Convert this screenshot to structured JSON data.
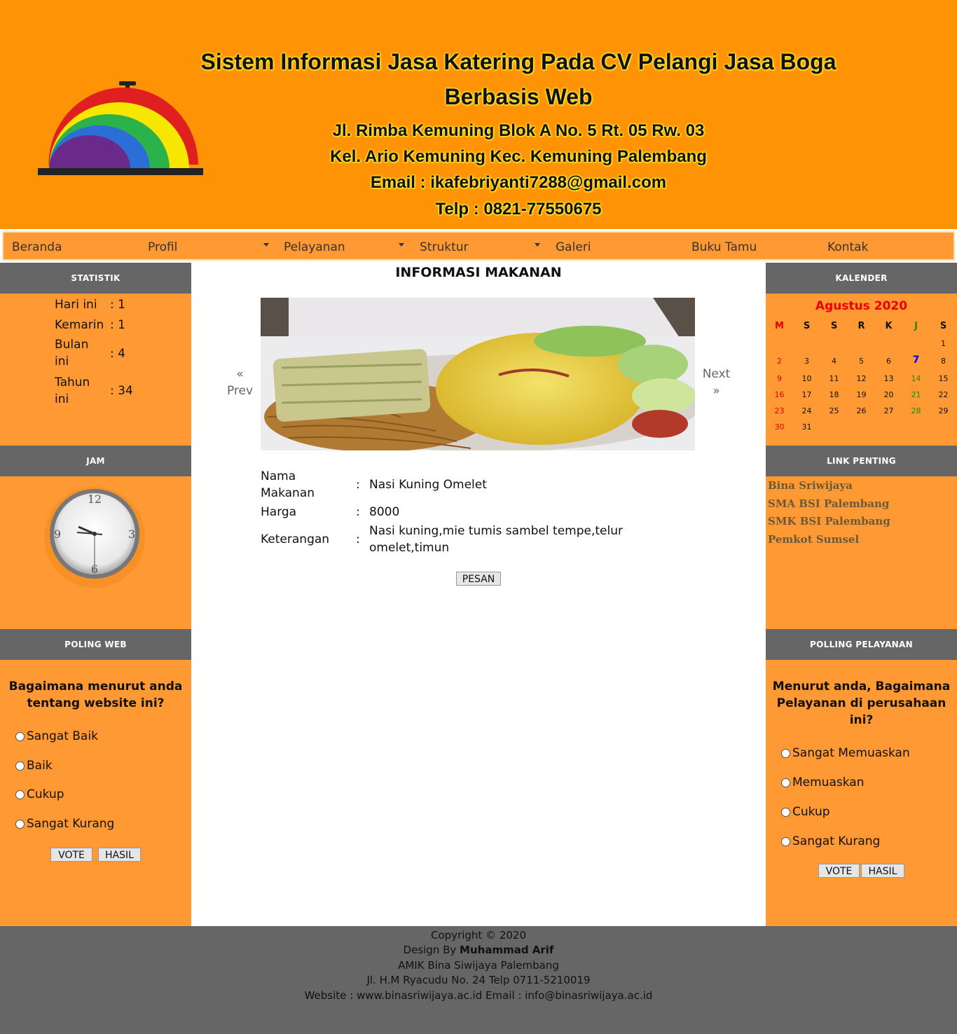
{
  "header": {
    "title_line1": "Sistem Informasi Jasa Katering Pada CV Pelangi Jasa Boga",
    "title_line2": "Berbasis Web",
    "address_line1": "Jl. Rimba Kemuning Blok A No. 5 Rt. 05 Rw. 03",
    "address_line2": "Kel. Ario Kemuning Kec. Kemuning Palembang",
    "email": "Email : ikafebriyanti7288@gmail.com",
    "phone": "Telp : 0821-77550675",
    "logo_icon": "rainbow-cloche-logo"
  },
  "nav": {
    "items": [
      {
        "label": "Beranda",
        "dropdown": false
      },
      {
        "label": "Profil",
        "dropdown": true
      },
      {
        "label": "Pelayanan",
        "dropdown": true
      },
      {
        "label": "Struktur",
        "dropdown": true
      },
      {
        "label": "Galeri",
        "dropdown": false
      },
      {
        "label": "Buku Tamu",
        "dropdown": false
      },
      {
        "label": "Kontak",
        "dropdown": false
      }
    ]
  },
  "statistik": {
    "title": "STATISTIK",
    "rows": [
      {
        "label_line1": "Hari ini",
        "label_line2": "",
        "value": ": 1"
      },
      {
        "label_line1": "Kemarin",
        "label_line2": "",
        "value": ": 1"
      },
      {
        "label_line1": "Bulan",
        "label_line2": "ini",
        "value": ": 4"
      },
      {
        "label_line1": "Tahun",
        "label_line2": "ini",
        "value": ": 34"
      }
    ]
  },
  "jam": {
    "title": "JAM",
    "numerals": [
      "12",
      "3",
      "6",
      "9"
    ]
  },
  "poling_web": {
    "title": "POLING WEB",
    "question_line1": "Bagaimana menurut anda",
    "question_line2": "tentang website ini?",
    "options": [
      "Sangat Baik",
      "Baik",
      "Cukup",
      "Sangat Kurang"
    ],
    "vote_label": "VOTE",
    "result_label": "HASIL"
  },
  "kalender": {
    "title": "KALENDER",
    "month": "Agustus 2020",
    "day_headers": [
      "M",
      "S",
      "S",
      "R",
      "K",
      "J",
      "S"
    ],
    "weeks": [
      [
        "",
        "",
        "",
        "",
        "",
        "",
        "1"
      ],
      [
        "2",
        "3",
        "4",
        "5",
        "6",
        "7",
        "8"
      ],
      [
        "9",
        "10",
        "11",
        "12",
        "13",
        "14",
        "15"
      ],
      [
        "16",
        "17",
        "18",
        "19",
        "20",
        "21",
        "22"
      ],
      [
        "23",
        "24",
        "25",
        "26",
        "27",
        "28",
        "29"
      ],
      [
        "30",
        "31",
        "",
        "",
        "",
        "",
        ""
      ]
    ],
    "today": "7",
    "colors": {
      "sunday": "#e00000",
      "friday": "#228b00",
      "today": "#0000ee"
    }
  },
  "link_penting": {
    "title": "LINK PENTING",
    "links": [
      "Bina Sriwijaya",
      "SMA BSI Palembang",
      "SMK BSI Palembang",
      "Pemkot Sumsel"
    ]
  },
  "polling_pelayanan": {
    "title": "POLLING PELAYANAN",
    "question_line1": "Menurut anda, Bagaimana",
    "question_line2": "Pelayanan di perusahaan",
    "question_line3": "ini?",
    "options": [
      "Sangat Memuaskan",
      "Memuaskan",
      "Cukup",
      "Sangat Kurang"
    ],
    "vote_label": "VOTE",
    "result_label": "HASIL"
  },
  "main": {
    "title": "INFORMASI MAKANAN",
    "prev_arrow": "«",
    "prev_label": "Prev",
    "next_label": "Next",
    "next_arrow": "»",
    "food_image_icon": "nasi-kuning-photo",
    "nama_label_line1": "Nama",
    "nama_label_line2": "Makanan",
    "nama_value": "Nasi Kuning Omelet",
    "harga_label": "Harga",
    "harga_value": "8000",
    "keterangan_label": "Keterangan",
    "keterangan_value": "Nasi kuning,mie tumis sambel tempe,telur omelet,timun",
    "colon": ":",
    "order_button": "PESAN"
  },
  "footer": {
    "copyright": "Copyright © 2020",
    "design_prefix": "Design By ",
    "designer": "Muhammad Arif",
    "institution": "AMIK Bina Siwijaya Palembang",
    "address": "Jl. H.M Ryacudu No. 24 Telp 0711-5210019",
    "contact": "Website : www.binasriwijaya.ac.id Email : info@binasriwijaya.ac.id"
  },
  "colors": {
    "header_bg": "#ff9306",
    "nav_bg": "#ff9933",
    "sidebar_bg": "#ff9933",
    "box_header_bg": "#666666",
    "footer_bg": "#666666"
  }
}
